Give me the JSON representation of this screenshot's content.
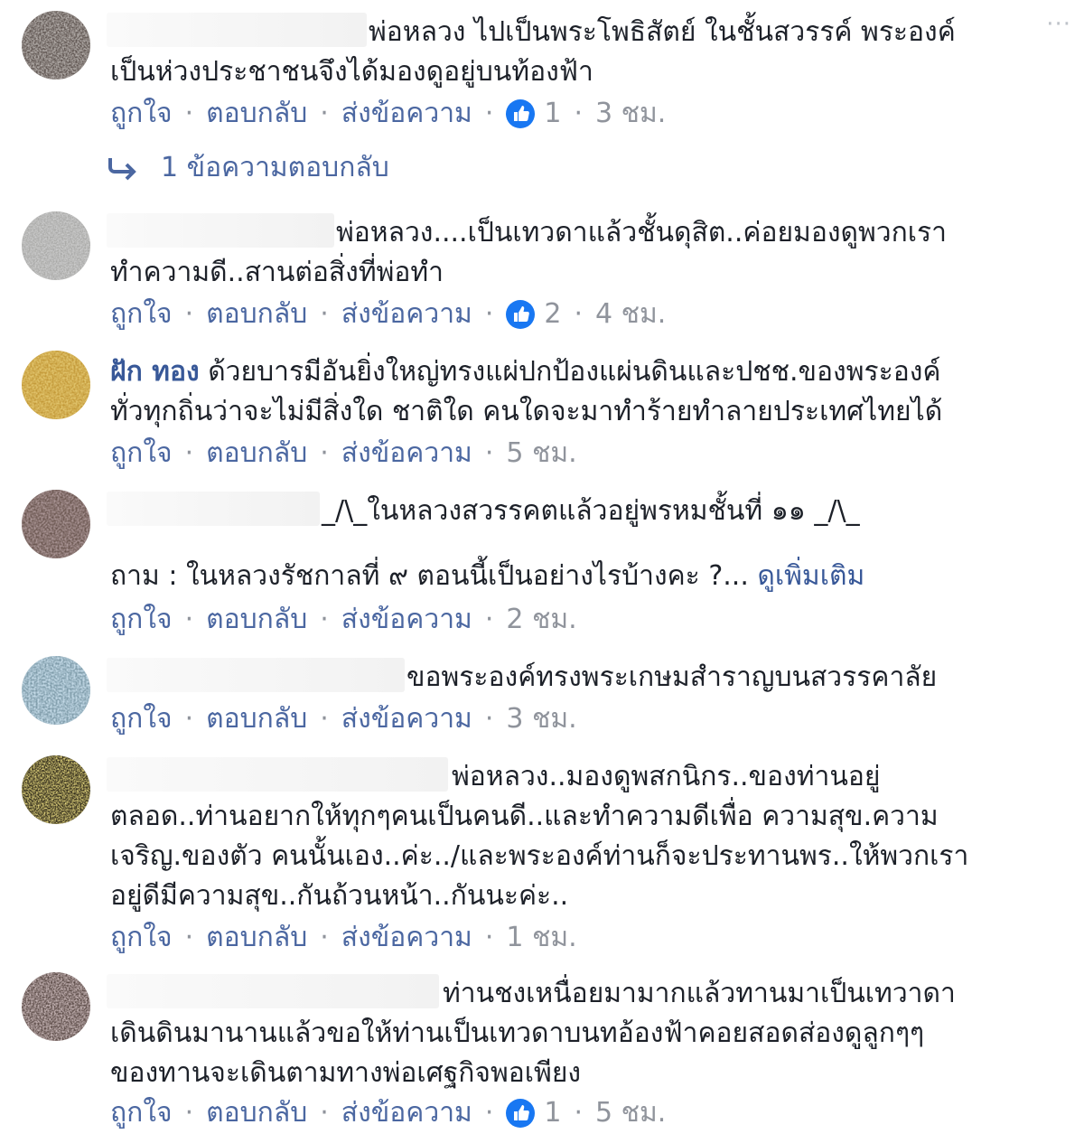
{
  "labels": {
    "like": "ถูกใจ",
    "reply": "ตอบกลับ",
    "message": "ส่งข้อความ",
    "separator": "·",
    "more": "···"
  },
  "colors": {
    "link": "#4b67a1",
    "author": "#385898",
    "meta": "#90949c",
    "text": "#1d2129",
    "like_blue": "#1877f2"
  },
  "comments": [
    {
      "author": "",
      "lines": [
        "พ่อหลวง ไปเป็นพระโพธิสัตย์ ในชั้นสวรรค์ พระองค์",
        "เป็นห่วงประชาชนจึงได้มองดูอยู่บนท้องฟ้า"
      ],
      "likes": "1",
      "time": "3 ชม.",
      "replies": "1 ข้อความตอบกลับ",
      "avatar_icon": "user-avatar-icon"
    },
    {
      "author": "",
      "lines": [
        "พ่อหลวง....เป็นเทวดาแล้วชั้นดุสิต..ค่อยมองดูพวกเรา",
        "ทำความดี..สานต่อสิ่งที่พ่อทำ"
      ],
      "likes": "2",
      "time": "4 ชม.",
      "avatar_icon": "user-avatar-icon"
    },
    {
      "author": "ฝัก ทอง",
      "lines": [
        "ด้วยบารมีอันยิ่งใหญ่ทรงแผ่ปกป้องแผ่นดินและปชช.ของพระองค์",
        "ทั่วทุกถิ่นว่าจะไม่มีสิ่งใด ชาติใด คนใดจะมาทำร้ายทำลายประเทศไทยได้"
      ],
      "time": "5 ชม.",
      "avatar_icon": "user-avatar-icon"
    },
    {
      "author": "",
      "lines": [
        "_/\\_ในหลวงสวรรคตแล้วอยู่พรหมชั้นที่ ๑๑ _/\\_",
        "ถาม : ในหลวงรัชกาลที่ ๙ ตอนนี้เป็นอย่างไรบ้างคะ ?..."
      ],
      "see_more": "ดูเพิ่มเติม",
      "time": "2 ชม.",
      "avatar_icon": "user-avatar-icon"
    },
    {
      "author": "",
      "lines": [
        "ขอพระองค์ทรงพระเกษมสำราญบนสวรรคาลัย"
      ],
      "time": "3 ชม.",
      "avatar_icon": "user-avatar-icon"
    },
    {
      "author": "",
      "lines": [
        "พ่อหลวง..มองดูพสกนิกร..ของท่านอยู่",
        "ตลอด..ท่านอยากให้ทุกๆคนเป็นคนดี..และทำความดีเพื่อ ความสุข.ความ",
        "เจริญ.ของตัว คนนั้นเอง..ค่ะ../และพระองค์ท่านก็จะประทานพร..ให้พวกเรา",
        "อยู่ดีมีความสุข..กันถ้วนหน้า..กันนะค่ะ.."
      ],
      "time": "1 ชม.",
      "avatar_icon": "user-avatar-icon"
    },
    {
      "author": "",
      "lines": [
        "ท่านชงเหนื่อยมามากแล้วทานมาเป็นเทวาดา",
        "เดินดินมานานแล้วขอให้ท่านเป็นเทวดาบนทอ้องฟ้าคอยสอดส่องดูลูกๆๆ",
        "ของทานจะเดินตามทางพ่อเศฐกิจพอเพียง"
      ],
      "likes": "1",
      "time": "5 ชม.",
      "avatar_icon": "user-avatar-icon"
    }
  ]
}
